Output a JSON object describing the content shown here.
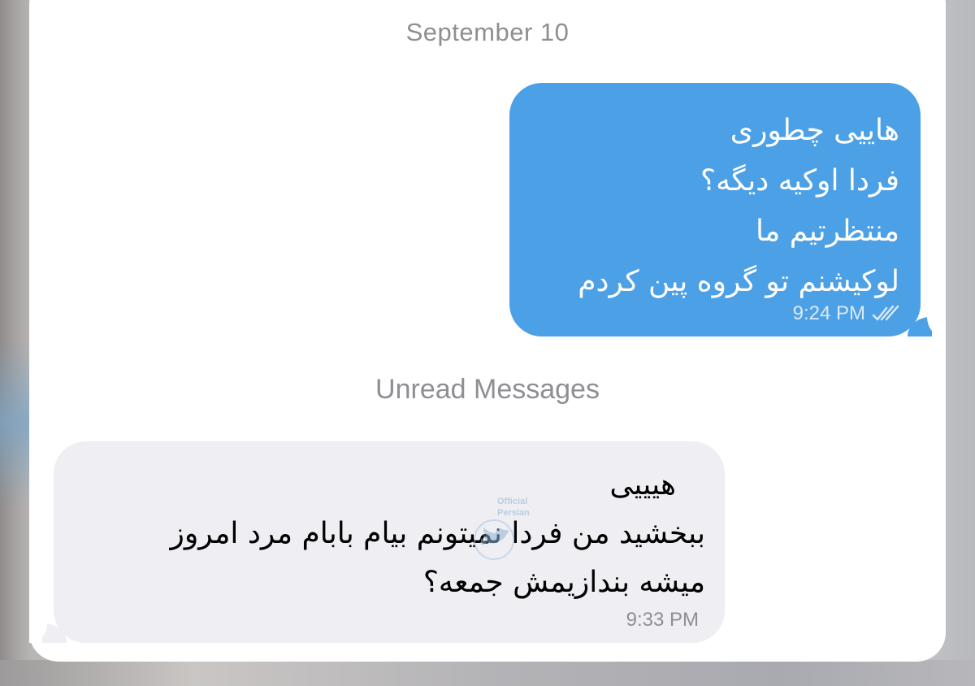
{
  "conversation": {
    "date_separator": "September 10",
    "unread_separator": "Unread Messages"
  },
  "outgoing_message": {
    "lines": [
      "هاییی چطوری",
      "فردا اوکیه دیگه؟",
      "منتظرتیم ما",
      "لوکیشنم تو گروه پین کردم"
    ],
    "time": "9:24 PM",
    "status_icon": "double-check-icon",
    "bubble_color": "#4ca0e6"
  },
  "incoming_message": {
    "lines": [
      "هیییی",
      "ببخشید من فردا نمیتونم بیام بابام مرد امروز",
      "میشه بندازیمش جمعه؟"
    ],
    "time": "9:33 PM",
    "bubble_color": "#eeeef3"
  },
  "watermark": {
    "line1": "Official",
    "line2": "Persian",
    "icon": "twitter-bird-icon"
  }
}
